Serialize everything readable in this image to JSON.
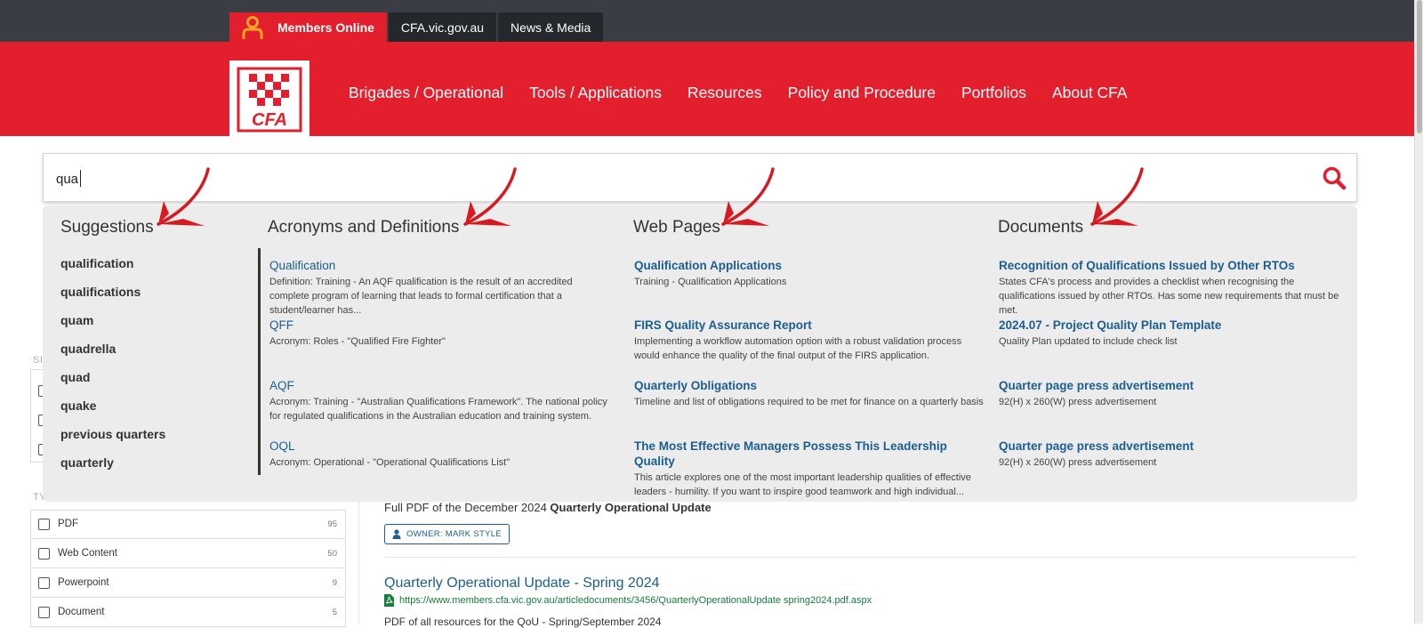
{
  "colors": {
    "brand_red": "#e31f2d",
    "topbar": "#3a3e44",
    "link_blue": "#1b5e8f",
    "url_green": "#167d3b"
  },
  "topbar": {
    "members_label": "Members Online",
    "links": [
      "CFA.vic.gov.au",
      "News & Media"
    ]
  },
  "logo": {
    "text": "CFA"
  },
  "nav": {
    "items": [
      "Brigades / Operational",
      "Tools / Applications",
      "Resources",
      "Policy and Procedure",
      "Portfolios",
      "About CFA"
    ]
  },
  "search": {
    "value": "qua",
    "icon": "search-icon"
  },
  "dropdown": {
    "headings": {
      "suggestions": "Suggestions",
      "acronyms": "Acronyms and Definitions",
      "web_pages": "Web Pages",
      "documents": "Documents"
    },
    "suggestions": [
      "qualification",
      "qualifications",
      "quam",
      "quadrella",
      "quad",
      "quake",
      "previous quarters",
      "quarterly"
    ],
    "acronyms": [
      {
        "title": "Qualification",
        "desc": "Definition: Training - An AQF qualification is the result of an accredited complete program of learning that leads to formal certification that a student/learner has..."
      },
      {
        "title": "QFF",
        "desc": "Acronym: Roles - \"Qualified Fire Fighter\""
      },
      {
        "title": "AQF",
        "desc": "Acronym: Training - \"Australian Qualifications Framework\". The national policy for regulated qualifications in the Australian education and training system."
      },
      {
        "title": "OQL",
        "desc": "Acronym: Operational - \"Operational Qualifications List\""
      }
    ],
    "web_pages": [
      {
        "title": "Qualification Applications",
        "desc": "Training - Qualification Applications"
      },
      {
        "title": "FIRS Quality Assurance Report",
        "desc": "Implementing a workflow automation option with a robust validation process would enhance the quality of the final output of the FIRS application."
      },
      {
        "title": "Quarterly Obligations",
        "desc": "Timeline and list of obligations required to be met for finance on a quarterly basis"
      },
      {
        "title": "The Most Effective Managers Possess This Leadership Quality",
        "desc": "This article explores one of the most important leadership qualities of effective leaders - humility. If you want to inspire good teamwork and high individual..."
      }
    ],
    "documents": [
      {
        "title": "Recognition of Qualifications Issued by Other RTOs",
        "desc": "States CFA's process and provides a checklist when recognising the qualifications issued by other RTOs. Has some new requirements that must be met."
      },
      {
        "title": "2024.07 - Project Quality Plan Template",
        "desc": "Quality Plan updated to include check list"
      },
      {
        "title": "Quarter page press advertisement",
        "desc": "92(H) x 260(W) press advertisement"
      },
      {
        "title": "Quarter page press advertisement",
        "desc": "92(H) x 260(W) press advertisement"
      }
    ]
  },
  "background": {
    "sidebar_label_1": "SI",
    "sidebar_label_2": "TY",
    "type_filters": [
      {
        "label": "PDF",
        "count": "95"
      },
      {
        "label": "Web Content",
        "count": "50"
      },
      {
        "label": "Powerpoint",
        "count": "9"
      },
      {
        "label": "Document",
        "count": "5"
      }
    ],
    "result1_text_prefix": "Full PDF of the December 2024 ",
    "result1_text_bold": "Quarterly Operational Update",
    "owner_badge": "OWNER: MARK STYLE",
    "result2_title": "Quarterly Operational Update - Spring 2024",
    "result2_url": "https://www.members.cfa.vic.gov.au/articledocuments/3456/QuarterlyOperationalUpdate spring2024.pdf.aspx",
    "result2_text": "PDF of all resources for the QoU - Spring/September 2024"
  }
}
